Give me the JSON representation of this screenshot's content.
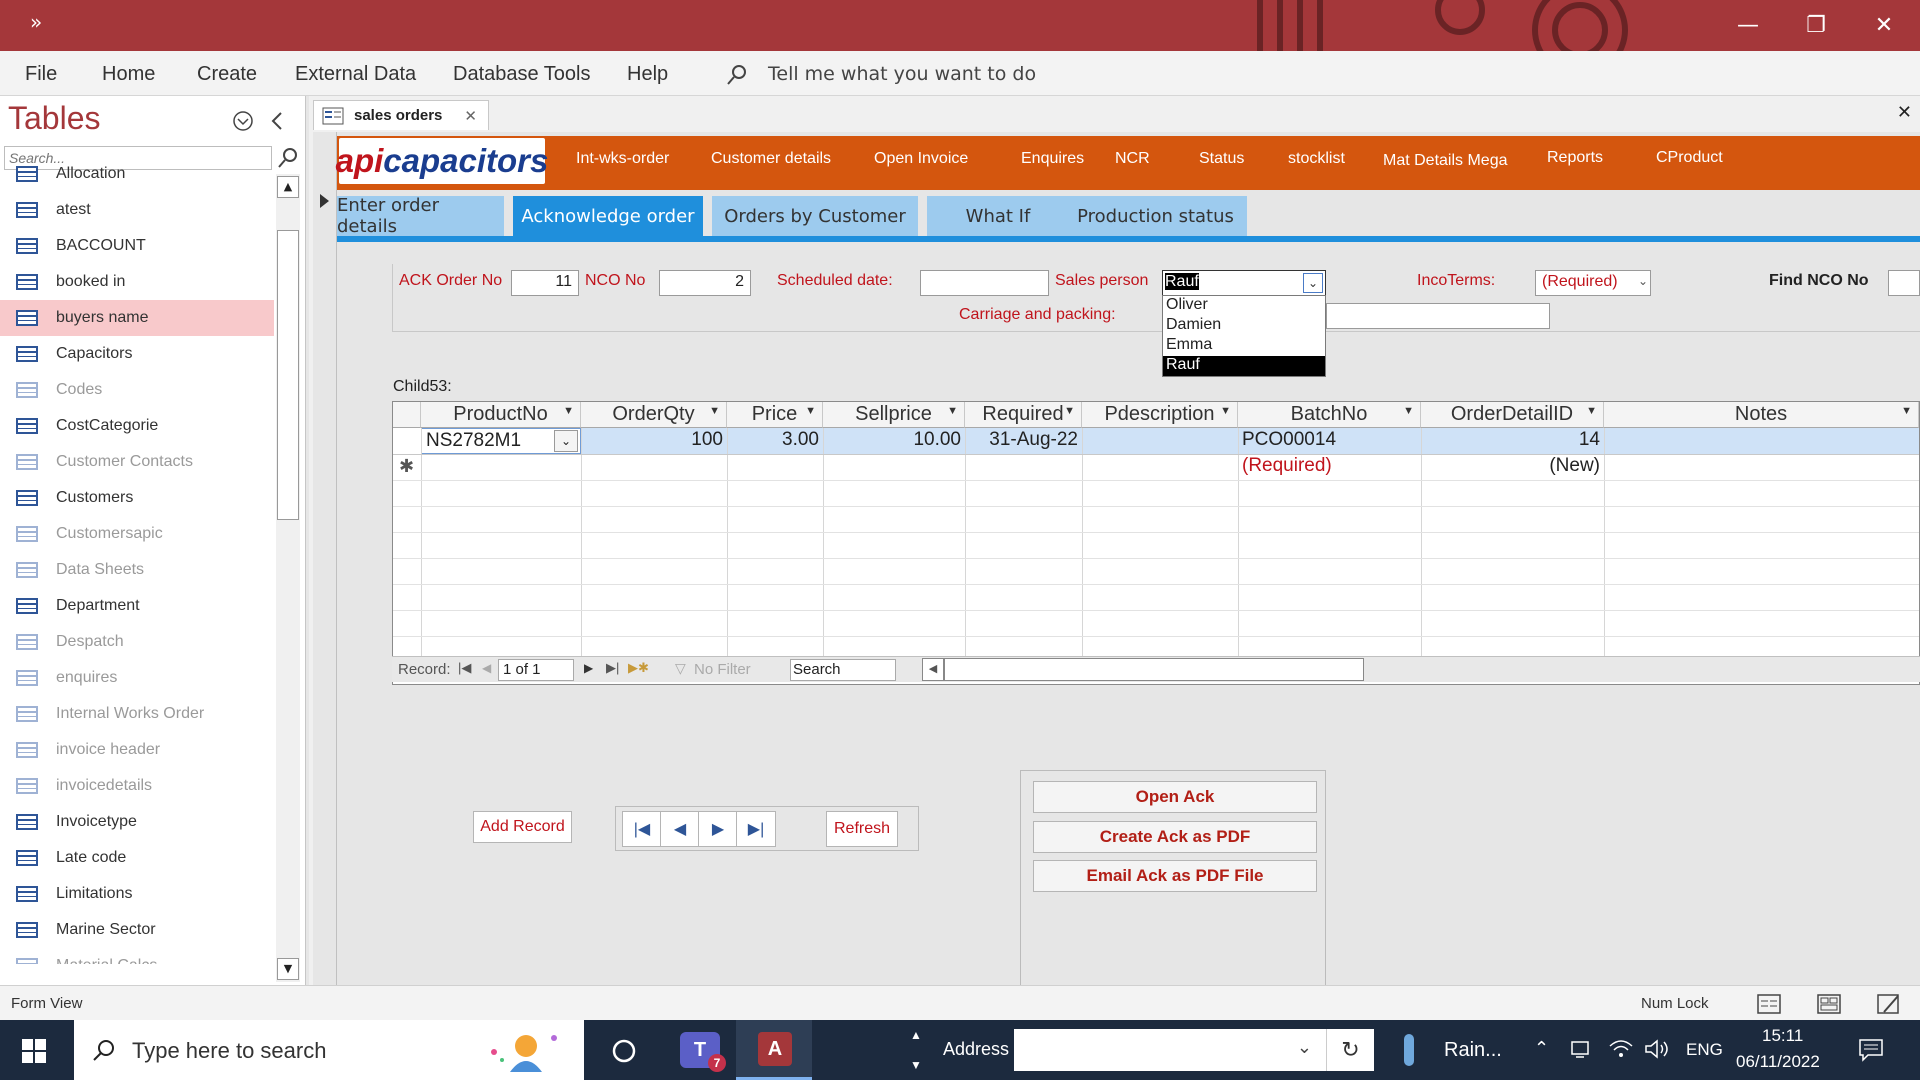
{
  "ribbon": {
    "menus": [
      "File",
      "Home",
      "Create",
      "External Data",
      "Database Tools",
      "Help"
    ],
    "tell_me": "Tell me what you want to do"
  },
  "nav": {
    "title": "Tables",
    "search_placeholder": "Search...",
    "items": [
      {
        "label": "Allocation",
        "dim": false
      },
      {
        "label": "atest",
        "dim": false
      },
      {
        "label": "BACCOUNT",
        "dim": false
      },
      {
        "label": "booked in",
        "dim": false
      },
      {
        "label": "buyers name",
        "dim": false,
        "selected": true
      },
      {
        "label": "Capacitors",
        "dim": false
      },
      {
        "label": "Codes",
        "dim": true
      },
      {
        "label": "CostCategorie",
        "dim": false
      },
      {
        "label": "Customer Contacts",
        "dim": true
      },
      {
        "label": "Customers",
        "dim": false
      },
      {
        "label": "Customersapic",
        "dim": true
      },
      {
        "label": "Data Sheets",
        "dim": true
      },
      {
        "label": "Department",
        "dim": false
      },
      {
        "label": "Despatch",
        "dim": true
      },
      {
        "label": "enquires",
        "dim": true
      },
      {
        "label": "Internal Works Order",
        "dim": true
      },
      {
        "label": "invoice header",
        "dim": true
      },
      {
        "label": "invoicedetails",
        "dim": true
      },
      {
        "label": "Invoicetype",
        "dim": false
      },
      {
        "label": "Late code",
        "dim": false
      },
      {
        "label": "Limitations",
        "dim": false
      },
      {
        "label": "Marine Sector",
        "dim": false
      },
      {
        "label": "Material Calcs",
        "dim": true
      }
    ]
  },
  "document": {
    "tab_label": "sales orders",
    "logo_part1": "api",
    "logo_part2": "capacitors",
    "header_links": [
      "Int-wks-order",
      "Customer details",
      "Open Invoice",
      "Enquires",
      "NCR",
      "Status",
      "stocklist",
      "Mat Details Mega",
      "Reports",
      "CProduct"
    ],
    "form_tabs": [
      "Enter order details",
      "Acknowledge order",
      "Orders by Customer",
      "What If",
      "Production status"
    ],
    "active_tab": "Acknowledge order"
  },
  "form": {
    "ack_label": "ACK Order No",
    "ack_value": "11",
    "nco_label": "NCO No",
    "nco_value": "2",
    "scheduled_label": "Scheduled date:",
    "scheduled_value": "",
    "sales_label": "Sales person",
    "sales_value": "Rauf",
    "sales_options": [
      "Oliver",
      "Damien",
      "Emma",
      "Rauf"
    ],
    "incoterms_label": "IncoTerms:",
    "incoterms_value": "(Required)",
    "find_label": "Find NCO No",
    "carriage_label": "Carriage  and packing:",
    "child_label": "Child53:"
  },
  "grid": {
    "columns": [
      "ProductNo",
      "OrderQty",
      "Price",
      "Sellprice",
      "Required",
      "Pdescription",
      "BatchNo",
      "OrderDetailID",
      "Notes"
    ],
    "row": {
      "ProductNo": "NS2782M1",
      "OrderQty": "100",
      "Price": "3.00",
      "Sellprice": "10.00",
      "Required": "31-Aug-22",
      "Pdescription": "",
      "BatchNo": "PCO00014",
      "OrderDetailID": "14",
      "Notes": ""
    },
    "new_row": {
      "BatchNo": "(Required)",
      "OrderDetailID": "(New)"
    },
    "recbar": {
      "record_label": "Record:",
      "position": "1 of 1",
      "filter": "No Filter",
      "search": "Search"
    }
  },
  "buttons": {
    "add_record": "Add Record",
    "refresh": "Refresh",
    "open_ack": "Open Ack",
    "create_pdf": "Create Ack as PDF",
    "email_pdf": "Email Ack as PDF File"
  },
  "status": {
    "left": "Form View",
    "numlock": "Num Lock"
  },
  "taskbar": {
    "search": "Type here to search",
    "address_label": "Address",
    "weather": "Rain...",
    "lang": "ENG",
    "time": "15:11",
    "date": "06/11/2022",
    "teams_badge": "7"
  },
  "colors": {
    "accent": "#a4373a",
    "header": "#d4560e",
    "tab": "#9dcbee",
    "tab_active": "#1f8fdc",
    "label_red": "#c0141c"
  }
}
